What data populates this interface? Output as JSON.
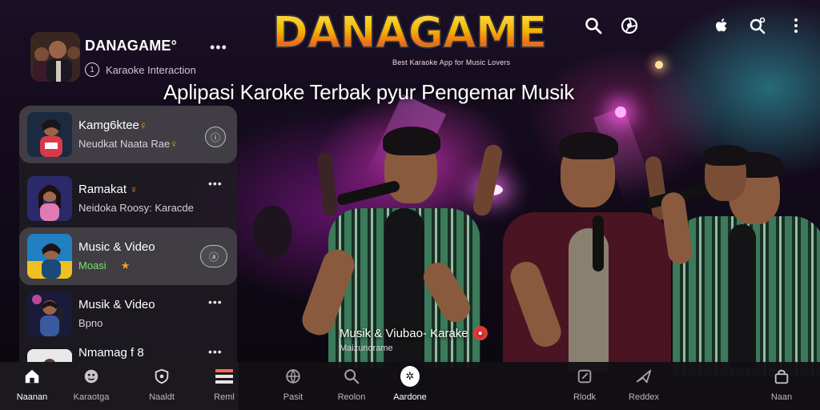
{
  "app": {
    "brand": "DANAGAME",
    "brand_subtitle": "Best Karaoke App for Music Lovers",
    "tagline": "Aplipasi Karoke Terbak pyur Pengemar Musik"
  },
  "top_icons": [
    "search-icon",
    "vinyl-icon",
    "apple-icon",
    "search-settings-icon",
    "more-vertical-icon"
  ],
  "profile": {
    "name": "DANAGAME°",
    "status": "Karaoke Interaction",
    "status_icon": "1"
  },
  "list": [
    {
      "title": "Kamg6ktee",
      "subtitle": "Neudkat Naata Rae",
      "emoji": "♀",
      "trailing": "round-button",
      "active": true
    },
    {
      "title": "Ramakat",
      "subtitle": "Neidoka Roosy: Karacde",
      "emoji": "♀",
      "trailing": "dots",
      "active": false
    },
    {
      "title": "Music & Video",
      "subtitle": "Moasi",
      "emoji": "★",
      "trailing": "round-button",
      "active": true
    },
    {
      "title": "Musik & Video",
      "subtitle": "Bpno",
      "emoji": "",
      "trailing": "dots",
      "active": false
    },
    {
      "title": "Nmamag f 8",
      "subtitle": "",
      "emoji": "",
      "trailing": "dots",
      "active": false
    }
  ],
  "caption": {
    "title": "Musik & Viubao- Karake",
    "subtitle": "Maizunorame"
  },
  "bottom_nav": [
    {
      "label": "Naanan",
      "icon": "home-icon",
      "active": true
    },
    {
      "label": "Karaotga",
      "icon": "face-icon",
      "active": false
    },
    {
      "label": "Naaldt",
      "icon": "shield-icon",
      "active": false
    },
    {
      "label": "Reml",
      "icon": "list-icon",
      "active": false
    },
    {
      "label": "Pasit",
      "icon": "globe-icon",
      "active": false
    },
    {
      "label": "Reolon",
      "icon": "search-icon",
      "active": false
    },
    {
      "label": "Aardone",
      "icon": "karaoke-icon",
      "active": true
    },
    {
      "label": "Rlodk",
      "icon": "edit-icon",
      "active": false
    },
    {
      "label": "Reddex",
      "icon": "plane-icon",
      "active": false
    },
    {
      "label": "Naan",
      "icon": "bag-icon",
      "active": false
    }
  ],
  "colors": {
    "accent_pink": "#ff3cdc",
    "accent_cyan": "#3cdce6",
    "brand_yellow": "#ffe04a",
    "brand_green": "#3fb63f",
    "status_green": "#7ae46a"
  }
}
